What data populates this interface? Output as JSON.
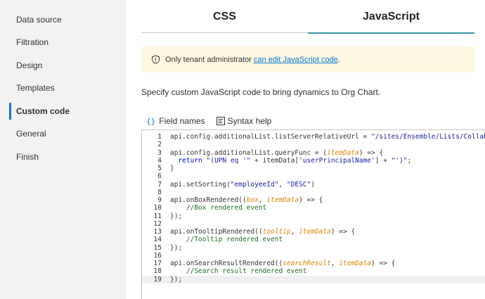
{
  "sidebar": {
    "items": [
      {
        "label": "Data source"
      },
      {
        "label": "Filtration"
      },
      {
        "label": "Design"
      },
      {
        "label": "Templates"
      },
      {
        "label": "Custom code",
        "active": true
      },
      {
        "label": "General"
      },
      {
        "label": "Finish"
      }
    ]
  },
  "tabs": {
    "css": "CSS",
    "javascript": "JavaScript",
    "active": "javascript"
  },
  "notice": {
    "icon": "shield-icon",
    "text": "Only tenant administrator ",
    "link": "can edit JavaScript code",
    "suffix": "."
  },
  "description": "Specify custom JavaScript code to bring dynamics to Org Chart.",
  "toolbar": {
    "field_names": "Field names",
    "syntax_help": "Syntax help"
  },
  "editor": {
    "active_line": 19,
    "lines": [
      {
        "n": "1",
        "parts": [
          [
            "api.config.additionalList.listServerRelativeUrl = ",
            ""
          ],
          [
            "\"/sites/Ensemble/Lists/Collaborate",
            "str"
          ]
        ]
      },
      {
        "n": "2",
        "parts": []
      },
      {
        "n": "3",
        "parts": [
          [
            "api.config.additionalList.queryFunc = (",
            ""
          ],
          [
            "itemData",
            "param"
          ],
          [
            ") => {",
            ""
          ]
        ]
      },
      {
        "n": "4",
        "parts": [
          [
            "  ",
            ""
          ],
          [
            "return",
            "kw"
          ],
          [
            " ",
            ""
          ],
          [
            "\"(UPN eq '\"",
            "str"
          ],
          [
            " + itemData[",
            ""
          ],
          [
            "'userPrincipalName'",
            "str"
          ],
          [
            "] + ",
            ""
          ],
          [
            "\"')\"",
            "str"
          ],
          [
            ";",
            ""
          ]
        ]
      },
      {
        "n": "5",
        "parts": [
          [
            "}",
            ""
          ]
        ]
      },
      {
        "n": "6",
        "parts": []
      },
      {
        "n": "7",
        "parts": [
          [
            "api.setSorting(",
            ""
          ],
          [
            "\"employeeId\"",
            "str"
          ],
          [
            ", ",
            ""
          ],
          [
            "\"DESC\"",
            "str"
          ],
          [
            ")",
            ""
          ]
        ]
      },
      {
        "n": "8",
        "parts": []
      },
      {
        "n": "9",
        "parts": [
          [
            "api.onBoxRendered((",
            ""
          ],
          [
            "box",
            "param"
          ],
          [
            ", ",
            ""
          ],
          [
            "itemData",
            "param"
          ],
          [
            ") => {",
            ""
          ]
        ]
      },
      {
        "n": "10",
        "parts": [
          [
            "    ",
            ""
          ],
          [
            "//Box rendered event",
            "com"
          ]
        ]
      },
      {
        "n": "11",
        "parts": [
          [
            "});",
            ""
          ]
        ]
      },
      {
        "n": "12",
        "parts": []
      },
      {
        "n": "13",
        "parts": [
          [
            "api.onTooltipRendered((",
            ""
          ],
          [
            "tooltip",
            "param"
          ],
          [
            ", ",
            ""
          ],
          [
            "itemData",
            "param"
          ],
          [
            ") => {",
            ""
          ]
        ]
      },
      {
        "n": "14",
        "parts": [
          [
            "    ",
            ""
          ],
          [
            "//Tooltip rendered event",
            "com"
          ]
        ]
      },
      {
        "n": "15",
        "parts": [
          [
            "});",
            ""
          ]
        ]
      },
      {
        "n": "16",
        "parts": []
      },
      {
        "n": "17",
        "parts": [
          [
            "api.onSearchResultRendered((",
            ""
          ],
          [
            "searchResult",
            "param"
          ],
          [
            ", ",
            ""
          ],
          [
            "itemData",
            "param"
          ],
          [
            ") => {",
            ""
          ]
        ]
      },
      {
        "n": "18",
        "parts": [
          [
            "    ",
            ""
          ],
          [
            "//Search result rendered event",
            "com"
          ]
        ]
      },
      {
        "n": "19",
        "parts": [
          [
            "});",
            ""
          ]
        ]
      }
    ]
  },
  "colors": {
    "accent": "#0078d4",
    "tab_underline": "#3a96a8",
    "notice_bg": "#fff8e1",
    "sidebar_bg": "#f3f2f1"
  }
}
